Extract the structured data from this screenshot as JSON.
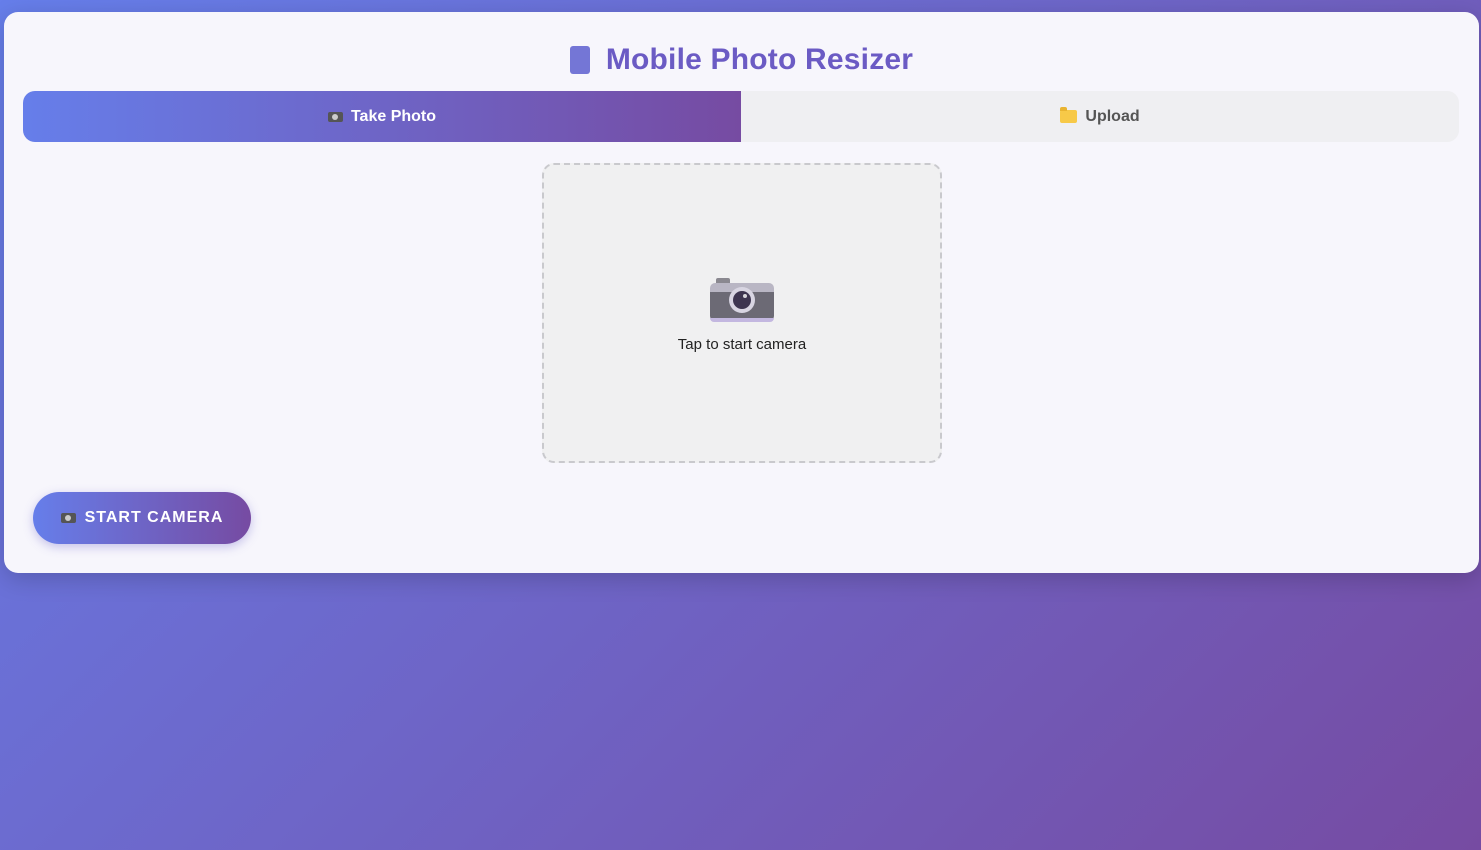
{
  "header": {
    "title": "Mobile Photo Resizer",
    "icon": "mobile-phone-icon"
  },
  "tabs": [
    {
      "label": "Take Photo",
      "icon": "camera-icon",
      "active": true
    },
    {
      "label": "Upload",
      "icon": "folder-icon",
      "active": false
    }
  ],
  "preview": {
    "icon": "camera-icon",
    "text": "Tap to start camera"
  },
  "actions": {
    "start_camera_label": "START CAMERA",
    "start_camera_icon": "camera-icon"
  },
  "colors": {
    "accent_start": "#667eea",
    "accent_end": "#764ba2",
    "title": "#6b5bc4"
  }
}
